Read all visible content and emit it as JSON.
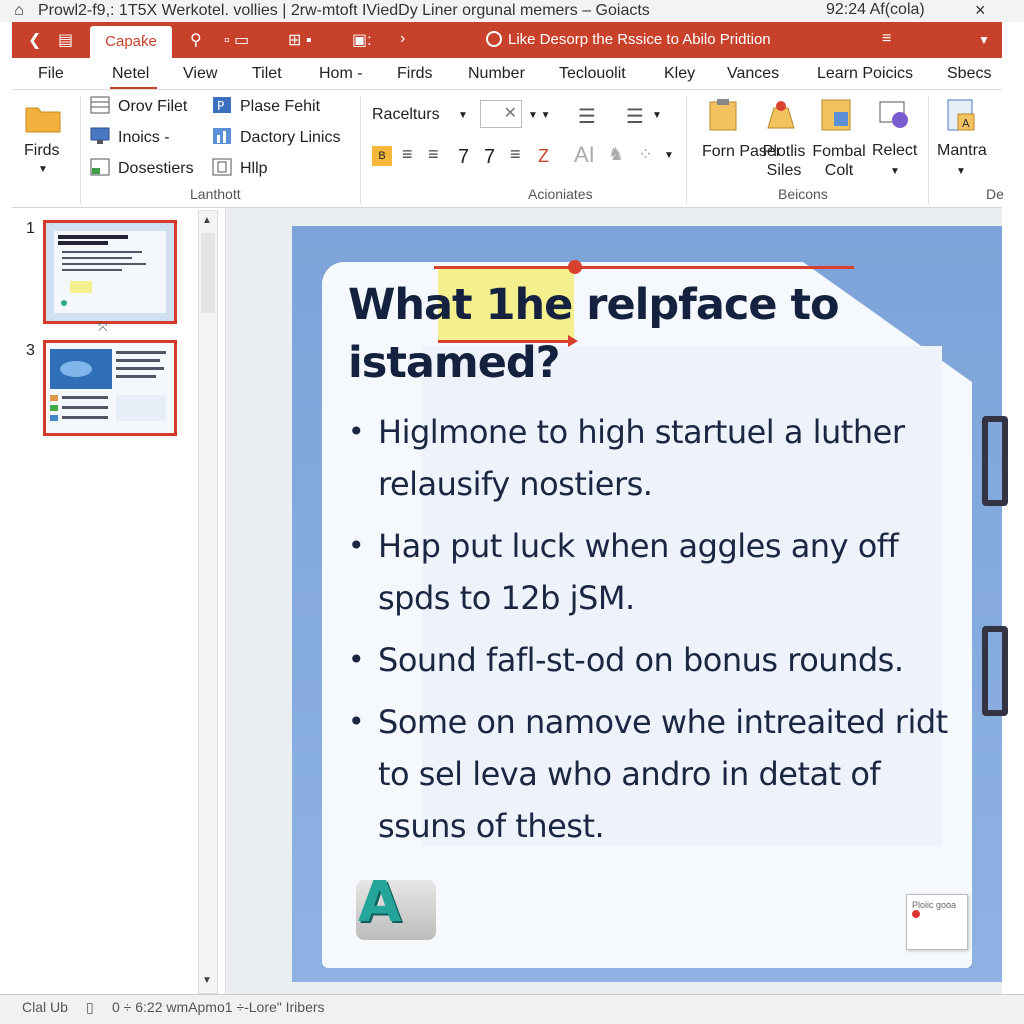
{
  "titlebar": {
    "title": "Prowl2-f9,: 1T5X Werkotel. vollies | 2rw-mtoft IViedDy Liner orgunal memers – Goiacts",
    "right": "92:24 Af(cola)"
  },
  "quick_access": {
    "active_tab": "Capaƙe",
    "doc_title": "Like Desorp the Rssice to Abilo Pridtion"
  },
  "menu": {
    "tabs": [
      "File",
      "Netel",
      "View",
      "Tilet",
      "Hom -",
      "Firds",
      "Number",
      "Teclouolit",
      "Kley",
      "Vances",
      "Learn Poicics",
      "Sbecs"
    ]
  },
  "ribbon": {
    "firds_label": "Firds",
    "group1": {
      "items": [
        "Orov Filet",
        "Inoics -",
        "Dosestiers"
      ],
      "items_b": [
        "Plase Fehit",
        "Dactory Linics",
        "Hllp"
      ],
      "label": "Lanthott"
    },
    "group2": {
      "font_label": "Racelturs",
      "glyphs": [
        "7",
        "7",
        "Z"
      ],
      "label": "Acioniates"
    },
    "group3": {
      "buttons": [
        "Forn Paser",
        "Plotlis Siles",
        "Fombal Colt",
        "Relect"
      ],
      "label": "Beicons"
    },
    "group4": {
      "button": "Mantra",
      "label": "De"
    }
  },
  "thumbnails": [
    {
      "number": "1"
    },
    {
      "number": "3"
    }
  ],
  "slide": {
    "title": "What 1he relpface to istamed?",
    "bullets": [
      "Higlmone to high startuel a luther relausify nostiers.",
      "Hap put luck when aggles any off spds to 12b jSM.",
      "Sound fafl-st-od on bonus rounds.",
      "Some on namove whe intreaited ridt to sel leva who andro in detat of ssuns of thest."
    ],
    "logo_letter": "A",
    "note_text": "Ploiic gooa"
  },
  "status": {
    "left": "Clal Ub",
    "center": "0 ÷ 6:22 wmApmo1 ÷-Lore\" Iribers"
  },
  "colors": {
    "accent": "#c8412b",
    "thumb_border": "#d33a2c",
    "slide_bg": "#8eb2e3",
    "title_text": "#14223f",
    "highlight": "#f5f08e"
  }
}
